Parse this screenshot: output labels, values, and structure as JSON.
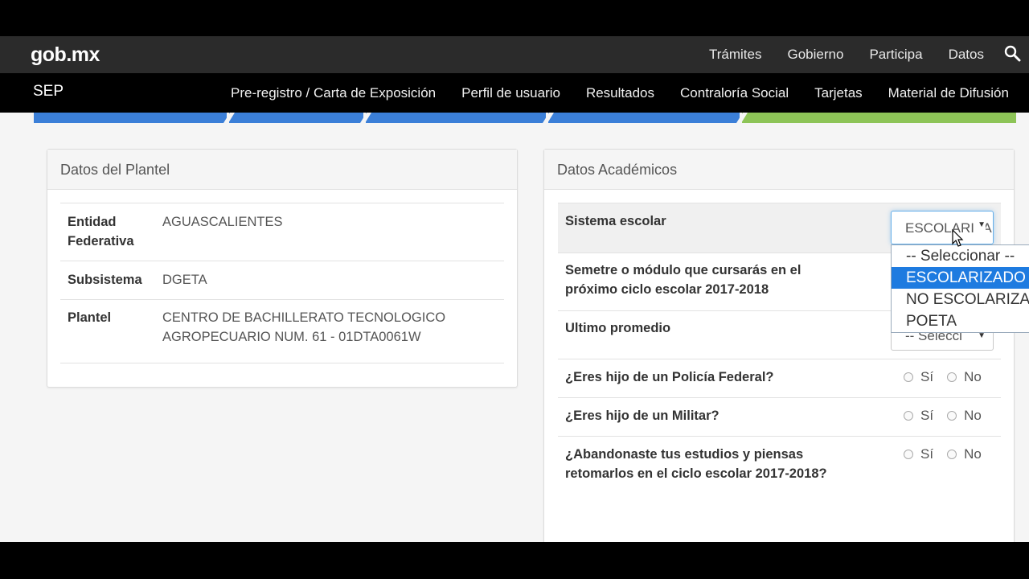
{
  "header": {
    "logo": "gob.mx",
    "links": [
      "Trámites",
      "Gobierno",
      "Participa",
      "Datos"
    ],
    "search_icon": "search-icon"
  },
  "subnav": {
    "brand": "SEP",
    "links": [
      "Pre-registro / Carta de Exposición",
      "Perfil de usuario",
      "Resultados",
      "Contraloría Social",
      "Tarjetas",
      "Material de Difusión"
    ]
  },
  "progress": {
    "segments_complete": 4,
    "segments_total": 5,
    "colors": {
      "done": "#3b7fd8",
      "current": "#8dc457"
    }
  },
  "plantel": {
    "title": "Datos del Plantel",
    "entidad_label_1": "Entidad",
    "entidad_label_2": "Federativa",
    "entidad_value": "AGUASCALIENTES",
    "subsistema_label": "Subsistema",
    "subsistema_value": "DGETA",
    "plantel_label": "Plantel",
    "plantel_value_1": "CENTRO DE BACHILLERATO TECNOLOGICO",
    "plantel_value_2": "AGROPECUARIO NUM. 61 - 01DTA0061W"
  },
  "academicos": {
    "title": "Datos Académicos",
    "sistema_label": "Sistema escolar",
    "sistema_value": "ESCOLARIZADO",
    "semestre_label_1": "Semetre o módulo que cursarás en el",
    "semestre_label_2": "próximo ciclo escolar 2017-2018",
    "promedio_label": "Ultimo promedio",
    "promedio_value": "-- Selecci",
    "policia_label": "¿Eres hijo de un Policía Federal?",
    "militar_label": "¿Eres hijo de un Militar?",
    "abandono_label_1": "¿Abandonaste tus estudios y piensas",
    "abandono_label_2": "retomarlos en el ciclo escolar 2017-2018?",
    "yes": "Sí",
    "no": "No"
  },
  "dropdown": {
    "options": [
      "-- Seleccionar --",
      "ESCOLARIZADO",
      "NO ESCOLARIZADO",
      "POETA"
    ],
    "selected_index": 1
  }
}
